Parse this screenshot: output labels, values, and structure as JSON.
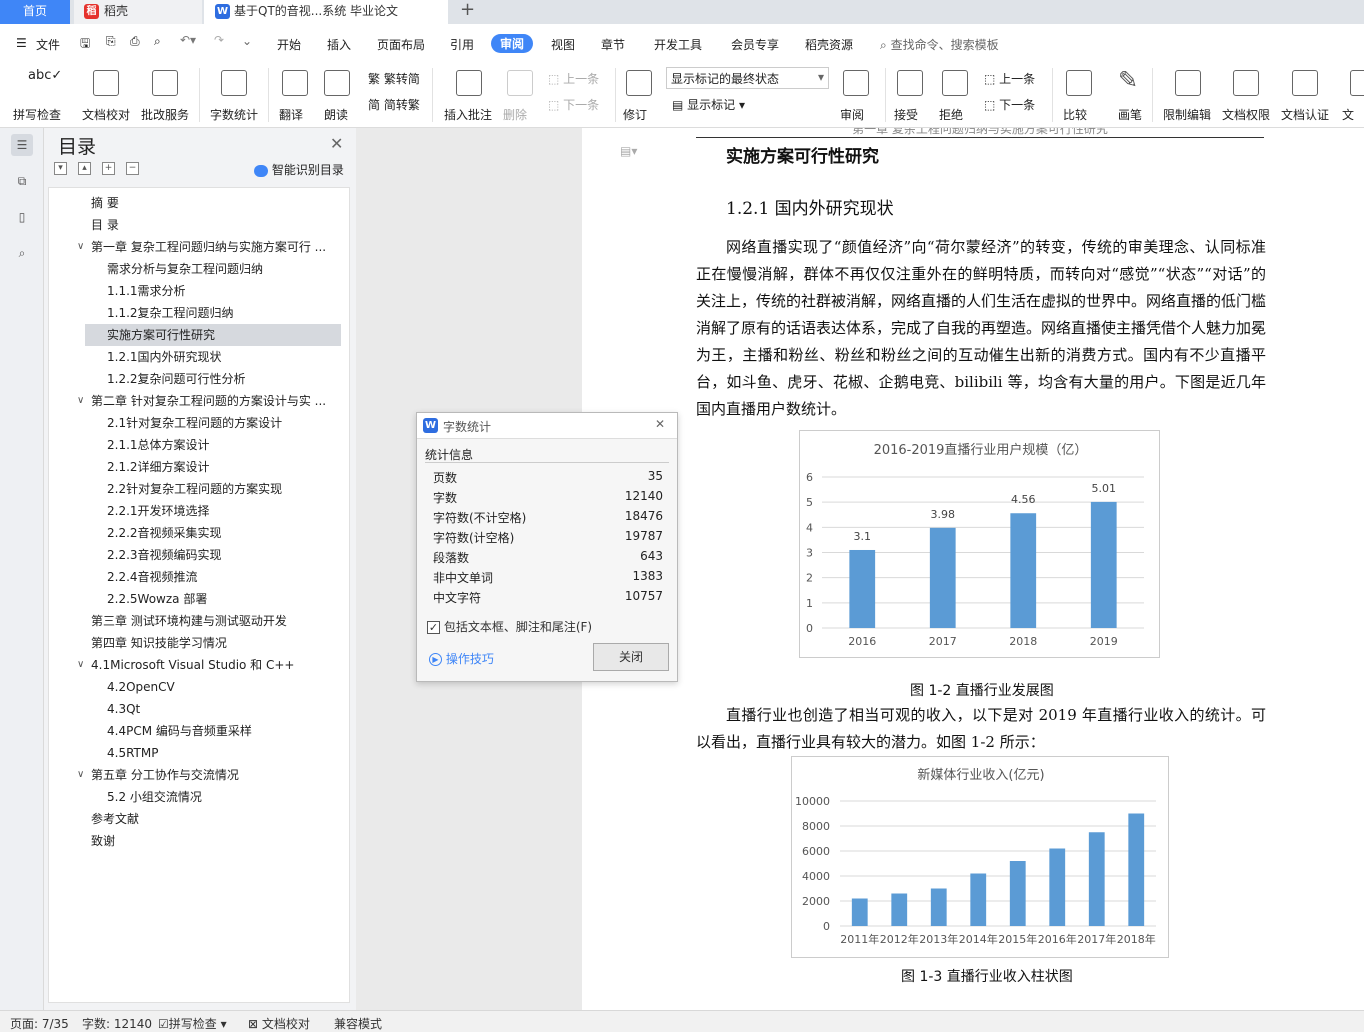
{
  "tabs": {
    "home": "首页",
    "daoke": "稻壳",
    "doc": "基于QT的音视...系统 毕业论文"
  },
  "menu": {
    "file": "文件",
    "items": [
      "开始",
      "插入",
      "页面布局",
      "引用",
      "审阅",
      "视图",
      "章节",
      "开发工具",
      "会员专享",
      "稻壳资源"
    ],
    "search": "查找命令、搜索模板"
  },
  "ribbon": {
    "spell": "拼写检查",
    "proof": "文档校对",
    "batch": "批改服务",
    "wordcount": "字数统计",
    "translate": "翻译",
    "read": "朗读",
    "trad": "繁转简",
    "simp": "简转繁",
    "insert_comment": "插入批注",
    "delete": "删除",
    "prev": "上一条",
    "next": "下一条",
    "revise": "修订",
    "track_state": "显示标记的最终状态",
    "show_marks": "显示标记",
    "review": "审阅",
    "accept": "接受",
    "reject": "拒绝",
    "prev2": "上一条",
    "next2": "下一条",
    "compare": "比较",
    "pen": "画笔",
    "restrict": "限制编辑",
    "perm": "文档权限",
    "auth": "文档认证",
    "doc_more": "文"
  },
  "nav": {
    "title": "目录",
    "smart": "智能识别目录",
    "items": [
      {
        "t": "摘 要",
        "lvl": 1,
        "arrow": ""
      },
      {
        "t": "目 录",
        "lvl": 1,
        "arrow": ""
      },
      {
        "t": "第一章 复杂工程问题归纳与实施方案可行 ...",
        "lvl": 1,
        "arrow": "v"
      },
      {
        "t": "需求分析与复杂工程问题归纳",
        "lvl": 2,
        "arrow": ""
      },
      {
        "t": "1.1.1需求分析",
        "lvl": 2,
        "arrow": ""
      },
      {
        "t": "1.1.2复杂工程问题归纳",
        "lvl": 2,
        "arrow": ""
      },
      {
        "t": "实施方案可行性研究",
        "lvl": 2,
        "arrow": "",
        "sel": true
      },
      {
        "t": "1.2.1国内外研究现状",
        "lvl": 2,
        "arrow": ""
      },
      {
        "t": "1.2.2复杂问题可行性分析",
        "lvl": 2,
        "arrow": ""
      },
      {
        "t": "第二章 针对复杂工程问题的方案设计与实 ...",
        "lvl": 1,
        "arrow": "v"
      },
      {
        "t": "2.1针对复杂工程问题的方案设计",
        "lvl": 2,
        "arrow": ""
      },
      {
        "t": "2.1.1总体方案设计",
        "lvl": 2,
        "arrow": ""
      },
      {
        "t": "2.1.2详细方案设计",
        "lvl": 2,
        "arrow": ""
      },
      {
        "t": "2.2针对复杂工程问题的方案实现",
        "lvl": 2,
        "arrow": ""
      },
      {
        "t": "2.2.1开发环境选择",
        "lvl": 2,
        "arrow": ""
      },
      {
        "t": "2.2.2音视频采集实现",
        "lvl": 2,
        "arrow": ""
      },
      {
        "t": "2.2.3音视频编码实现",
        "lvl": 2,
        "arrow": ""
      },
      {
        "t": "2.2.4音视频推流",
        "lvl": 2,
        "arrow": ""
      },
      {
        "t": "2.2.5Wowza 部署",
        "lvl": 2,
        "arrow": ""
      },
      {
        "t": "第三章 测试环境构建与测试驱动开发",
        "lvl": 1,
        "arrow": ""
      },
      {
        "t": "第四章 知识技能学习情况",
        "lvl": 1,
        "arrow": ""
      },
      {
        "t": "4.1Microsoft Visual Studio 和 C++",
        "lvl": 1,
        "arrow": "v"
      },
      {
        "t": "4.2OpenCV",
        "lvl": 2,
        "arrow": ""
      },
      {
        "t": "4.3Qt",
        "lvl": 2,
        "arrow": ""
      },
      {
        "t": "4.4PCM 编码与音频重采样",
        "lvl": 2,
        "arrow": ""
      },
      {
        "t": "4.5RTMP",
        "lvl": 2,
        "arrow": ""
      },
      {
        "t": "第五章 分工协作与交流情况",
        "lvl": 1,
        "arrow": "v"
      },
      {
        "t": "5.2 小组交流情况",
        "lvl": 2,
        "arrow": ""
      },
      {
        "t": "参考文献",
        "lvl": 1,
        "arrow": ""
      },
      {
        "t": "致谢",
        "lvl": 1,
        "arrow": ""
      }
    ]
  },
  "doc": {
    "header_cut": "第一章 复杂工程问题归纳与实施方案可行性研究",
    "h1": "实施方案可行性研究",
    "h2": "1.2.1  国内外研究现状",
    "p1": "网络直播实现了“颜值经济”向“荷尔蒙经济”的转变，传统的审美理念、认同标准正在慢慢消解，群体不再仅仅注重外在的鲜明特质，而转向对“感觉”“状态”“对话”的关注上，传统的社群被消解，网络直播的人们生活在虚拟的世界中。网络直播的低门槛消解了原有的话语表达体系，完成了自我的再塑造。网络直播使主播凭借个人魅力加冕为王，主播和粉丝、粉丝和粉丝之间的互动催生出新的消费方式。国内有不少直播平台，如斗鱼、虎牙、花椒、企鹅电竞、bilibili 等，均含有大量的用户。下图是近几年国内直播用户数统计。",
    "cap1": "图 1-2 直播行业发展图",
    "p2": "直播行业也创造了相当可观的收入，以下是对  2019 年直播行业收入的统计。可以看出，直播行业具有较大的潜力。如图  1-2 所示：",
    "cap2": "图 1-3  直播行业收入柱状图"
  },
  "chart_data": [
    {
      "type": "bar",
      "title": "2016-2019直播行业用户规模（亿）",
      "categories": [
        "2016",
        "2017",
        "2018",
        "2019"
      ],
      "values": [
        3.1,
        3.98,
        4.56,
        5.01
      ],
      "labels": [
        "3.1",
        "3.98",
        "4.56",
        "5.01"
      ],
      "ylim": [
        0,
        6
      ],
      "yticks": [
        "0",
        "1",
        "2",
        "3",
        "4",
        "5",
        "6"
      ],
      "color": "#5b9bd5"
    },
    {
      "type": "bar",
      "title": "新媒体行业收入(亿元)",
      "categories": [
        "2011年",
        "2012年",
        "2013年",
        "2014年",
        "2015年",
        "2016年",
        "2017年",
        "2018年"
      ],
      "values": [
        2200,
        2600,
        3000,
        4200,
        5200,
        6200,
        7500,
        9000
      ],
      "ylim": [
        0,
        10000
      ],
      "yticks": [
        "0",
        "2000",
        "4000",
        "6000",
        "8000",
        "10000"
      ],
      "color": "#5b9bd5"
    }
  ],
  "dialog": {
    "title": "字数统计",
    "section": "统计信息",
    "rows": [
      {
        "k": "页数",
        "v": "35"
      },
      {
        "k": "字数",
        "v": "12140"
      },
      {
        "k": "字符数(不计空格)",
        "v": "18476"
      },
      {
        "k": "字符数(计空格)",
        "v": "19787"
      },
      {
        "k": "段落数",
        "v": "643"
      },
      {
        "k": "非中文单词",
        "v": "1383"
      },
      {
        "k": "中文字符",
        "v": "10757"
      }
    ],
    "checkbox": "包括文本框、脚注和尾注(F)",
    "tips": "操作技巧",
    "close": "关闭"
  },
  "status": {
    "page": "页面: 7/35",
    "words": "字数: 12140",
    "spell": "拼写检查",
    "proof": "文档校对",
    "compat": "兼容模式"
  }
}
